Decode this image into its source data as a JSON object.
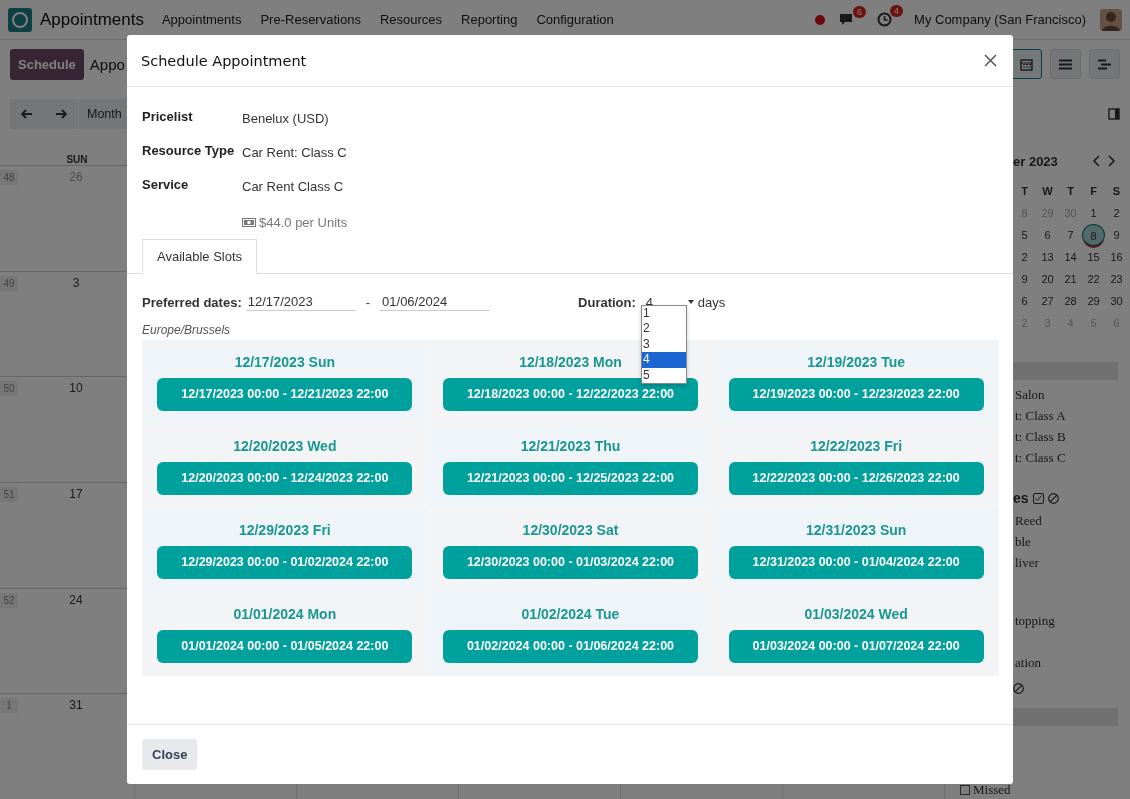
{
  "navbar": {
    "app_name": "Appointments",
    "menu": [
      "Appointments",
      "Pre-Reservations",
      "Resources",
      "Reporting",
      "Configuration"
    ],
    "messages_badge": "6",
    "activities_badge": "4",
    "company": "My Company (San Francisco)"
  },
  "control_bar": {
    "schedule_button": "Schedule",
    "title": "Appo",
    "views": [
      {
        "kind": "calendar",
        "selected": true
      },
      {
        "kind": "list",
        "selected": false
      },
      {
        "kind": "gantt",
        "selected": false
      }
    ]
  },
  "calendar_toolbar": {
    "month_button": "Month"
  },
  "calendar": {
    "day_header": "SUN",
    "weeks": [
      {
        "week": "48",
        "day": "26",
        "other_month": true
      },
      {
        "week": "49",
        "day": "3",
        "other_month": false
      },
      {
        "week": "50",
        "day": "10",
        "other_month": false
      },
      {
        "week": "51",
        "day": "17",
        "other_month": false
      },
      {
        "week": "52",
        "day": "24",
        "other_month": false
      },
      {
        "week": "1",
        "day": "31",
        "other_month": false
      }
    ]
  },
  "sidebar": {
    "month_title": "er 2023",
    "weekdays": [
      "T",
      "W",
      "T",
      "F",
      "S"
    ],
    "weeks": [
      [
        {
          "day": "8",
          "muted": true,
          "today": false
        },
        {
          "day": "29",
          "muted": true,
          "today": false
        },
        {
          "day": "30",
          "muted": true,
          "today": false
        },
        {
          "day": "1",
          "muted": false,
          "today": false
        },
        {
          "day": "2",
          "muted": false,
          "today": false
        }
      ],
      [
        {
          "day": "5",
          "muted": false,
          "today": false
        },
        {
          "day": "6",
          "muted": false,
          "today": false
        },
        {
          "day": "7",
          "muted": false,
          "today": false
        },
        {
          "day": "8",
          "muted": false,
          "today": true
        },
        {
          "day": "9",
          "muted": false,
          "today": false
        }
      ],
      [
        {
          "day": "2",
          "muted": false,
          "today": false
        },
        {
          "day": "13",
          "muted": false,
          "today": false
        },
        {
          "day": "14",
          "muted": false,
          "today": false
        },
        {
          "day": "15",
          "muted": false,
          "today": false
        },
        {
          "day": "16",
          "muted": false,
          "today": false
        }
      ],
      [
        {
          "day": "9",
          "muted": false,
          "today": false
        },
        {
          "day": "20",
          "muted": false,
          "today": false
        },
        {
          "day": "21",
          "muted": false,
          "today": false
        },
        {
          "day": "22",
          "muted": false,
          "today": false
        },
        {
          "day": "23",
          "muted": false,
          "today": false
        }
      ],
      [
        {
          "day": "6",
          "muted": false,
          "today": false
        },
        {
          "day": "27",
          "muted": false,
          "today": false
        },
        {
          "day": "28",
          "muted": false,
          "today": false
        },
        {
          "day": "29",
          "muted": false,
          "today": false
        },
        {
          "day": "30",
          "muted": false,
          "today": false
        }
      ],
      [
        {
          "day": "2",
          "muted": true,
          "today": false
        },
        {
          "day": "3",
          "muted": true,
          "today": false
        },
        {
          "day": "4",
          "muted": true,
          "today": false
        },
        {
          "day": "5",
          "muted": true,
          "today": false
        },
        {
          "day": "6",
          "muted": true,
          "today": false
        }
      ]
    ],
    "resources": [
      "Salon",
      "t: Class A",
      "t: Class B",
      "t: Class C"
    ],
    "attendees_title": "es",
    "attendees": [
      "Reed",
      "ble",
      "liver",
      "topping",
      "ation"
    ],
    "missed": {
      "label": "Missed",
      "checked": false
    }
  },
  "dialog": {
    "title": "Schedule Appointment",
    "fields": [
      {
        "label": "Pricelist",
        "value": "Benelux (USD)"
      },
      {
        "label": "Resource Type",
        "value": "Car Rent: Class C"
      },
      {
        "label": "Service",
        "value": "Car Rent Class C"
      }
    ],
    "price": "$44.0 per Units",
    "tabs": [
      {
        "label": "Available Slots",
        "selected": true
      }
    ],
    "preferred_dates": {
      "label": "Preferred dates:",
      "from": "12/17/2023",
      "separator": "-",
      "to": "01/06/2024"
    },
    "duration": {
      "label": "Duration:",
      "value": "4",
      "unit": "days",
      "options": [
        {
          "label": "1",
          "selected": false
        },
        {
          "label": "2",
          "selected": false
        },
        {
          "label": "3",
          "selected": false
        },
        {
          "label": "4",
          "selected": true
        },
        {
          "label": "5",
          "selected": false
        }
      ]
    },
    "timezone": "Europe/Brussels",
    "slots": [
      {
        "date": "12/17/2023 Sun",
        "range": "12/17/2023 00:00 - 12/21/2023 22:00"
      },
      {
        "date": "12/18/2023 Mon",
        "range": "12/18/2023 00:00 - 12/22/2023 22:00"
      },
      {
        "date": "12/19/2023 Tue",
        "range": "12/19/2023 00:00 - 12/23/2023 22:00"
      },
      {
        "date": "12/20/2023 Wed",
        "range": "12/20/2023 00:00 - 12/24/2023 22:00"
      },
      {
        "date": "12/21/2023 Thu",
        "range": "12/21/2023 00:00 - 12/25/2023 22:00"
      },
      {
        "date": "12/22/2023 Fri",
        "range": "12/22/2023 00:00 - 12/26/2023 22:00"
      },
      {
        "date": "12/29/2023 Fri",
        "range": "12/29/2023 00:00 - 01/02/2024 22:00"
      },
      {
        "date": "12/30/2023 Sat",
        "range": "12/30/2023 00:00 - 01/03/2024 22:00"
      },
      {
        "date": "12/31/2023 Sun",
        "range": "12/31/2023 00:00 - 01/04/2024 22:00"
      },
      {
        "date": "01/01/2024 Mon",
        "range": "01/01/2024 00:00 - 01/05/2024 22:00"
      },
      {
        "date": "01/02/2024 Tue",
        "range": "01/02/2024 00:00 - 01/06/2024 22:00"
      },
      {
        "date": "01/03/2024 Wed",
        "range": "01/03/2024 00:00 - 01/07/2024 22:00"
      }
    ],
    "close_button": "Close"
  }
}
